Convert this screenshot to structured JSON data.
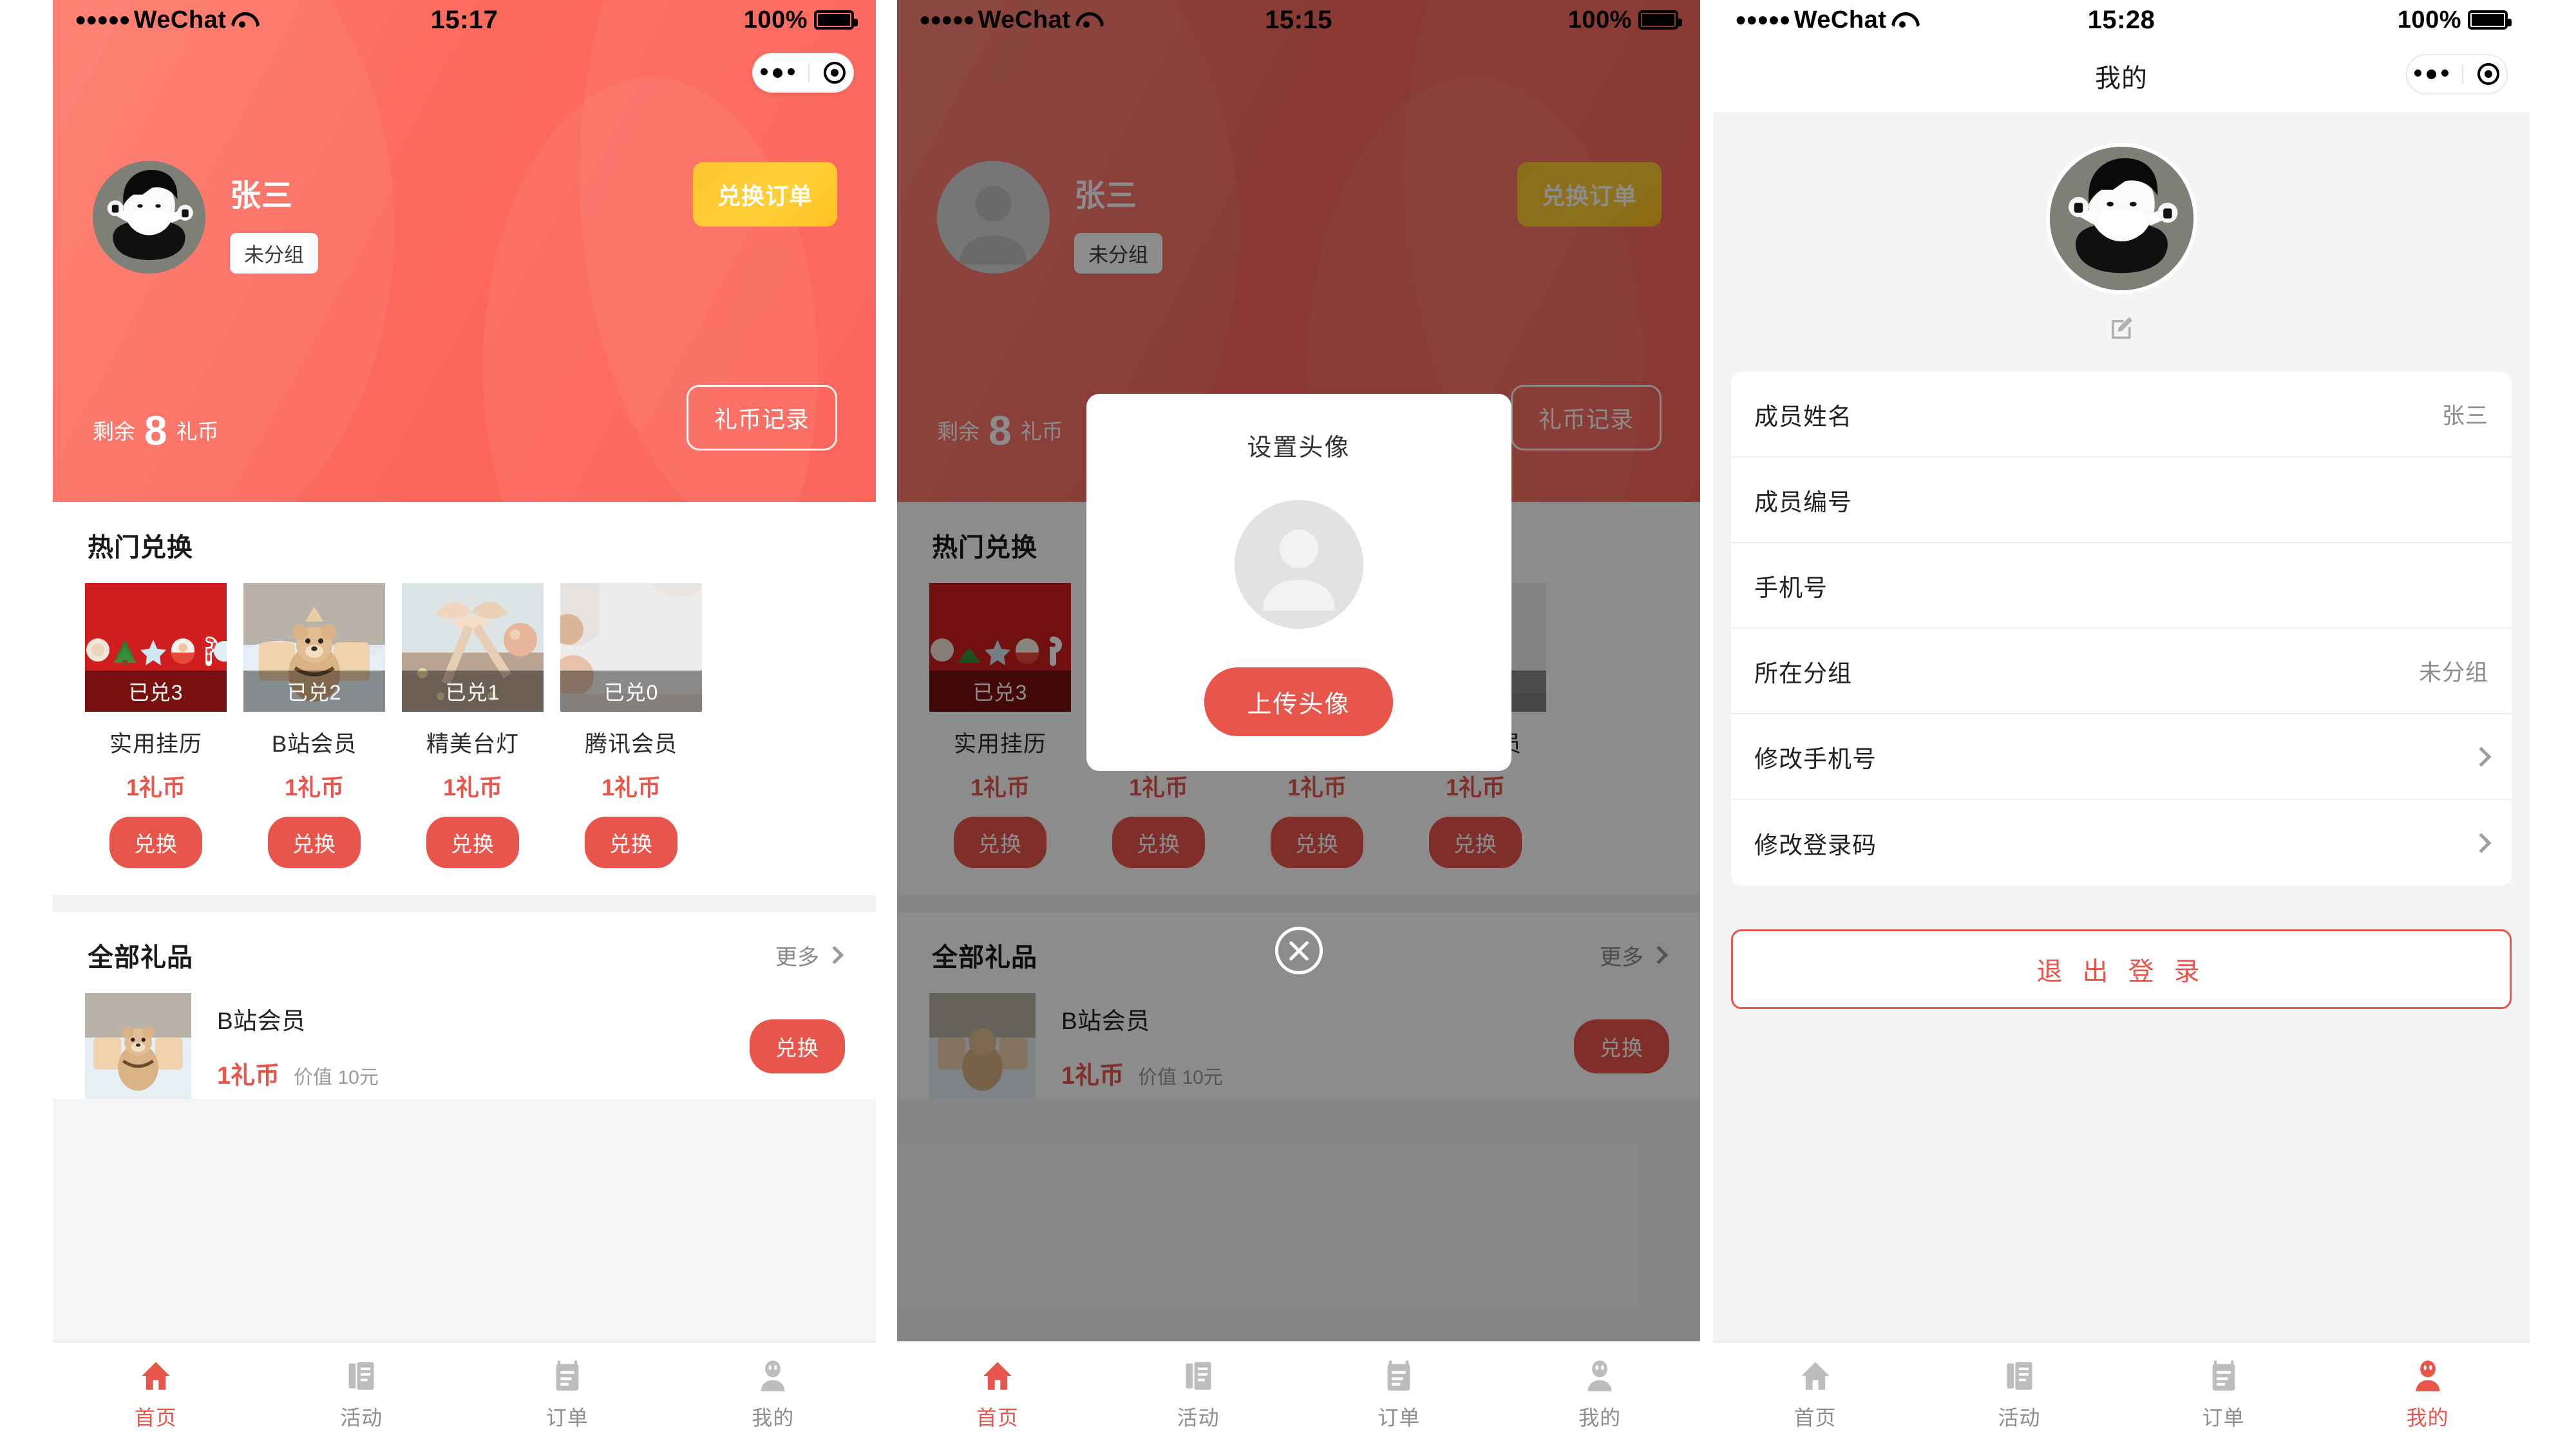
{
  "brand": {
    "accent_red": "#e8554b",
    "header_red": "#fc6a5e",
    "gold": "#ffc530",
    "muted": "#8e8e8e"
  },
  "panels": [
    {
      "status": {
        "carrier": "WeChat",
        "dots": "●●●●●",
        "time": "15:17",
        "battery": "100%"
      }
    },
    {
      "status": {
        "carrier": "WeChat",
        "dots": "●●●●●",
        "time": "15:15",
        "battery": "100%"
      }
    },
    {
      "status": {
        "carrier": "WeChat",
        "dots": "●●●●●",
        "time": "15:28",
        "battery": "100%"
      }
    }
  ],
  "home": {
    "user_name": "张三",
    "group_tag": "未分组",
    "order_button": "兑换订单",
    "coin_label": "剩余",
    "coin_count": "8",
    "coin_unit": "礼币",
    "record_button": "礼币记录",
    "hot_section_title": "热门兑换",
    "all_section_title": "全部礼品",
    "more_label": "更多",
    "hot_items": [
      {
        "name": "实用挂历",
        "price": "1礼币",
        "badge": "已兑3",
        "button": "兑换"
      },
      {
        "name": "B站会员",
        "price": "1礼币",
        "badge": "已兑2",
        "button": "兑换"
      },
      {
        "name": "精美台灯",
        "price": "1礼币",
        "badge": "已兑1",
        "button": "兑换"
      },
      {
        "name": "腾讯会员",
        "price": "1礼币",
        "badge": "已兑0",
        "button": "兑换"
      }
    ],
    "all_items": [
      {
        "name": "B站会员",
        "price": "1礼币",
        "value": "价值 10元",
        "button": "兑换"
      }
    ]
  },
  "modal": {
    "title": "设置头像",
    "upload_button": "上传头像",
    "close_label": "关闭"
  },
  "profile": {
    "nav_title": "我的",
    "rows": [
      {
        "label": "成员姓名",
        "value": "张三",
        "chevron": false
      },
      {
        "label": "成员编号",
        "value": "",
        "chevron": false
      },
      {
        "label": "手机号",
        "value": "",
        "chevron": false
      },
      {
        "label": "所在分组",
        "value": "未分组",
        "chevron": false
      },
      {
        "label": "修改手机号",
        "value": "",
        "chevron": true
      },
      {
        "label": "修改登录码",
        "value": "",
        "chevron": true
      }
    ],
    "logout_button": "退 出 登 录"
  },
  "tabs": [
    {
      "label": "首页",
      "icon": "home-icon"
    },
    {
      "label": "活动",
      "icon": "activity-icon"
    },
    {
      "label": "订单",
      "icon": "order-icon"
    },
    {
      "label": "我的",
      "icon": "profile-icon"
    }
  ]
}
